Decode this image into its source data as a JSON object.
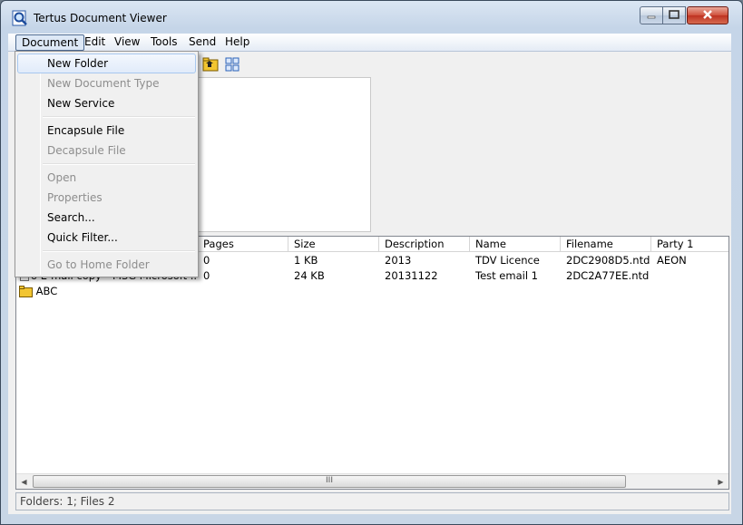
{
  "window": {
    "title": "Tertus Document Viewer"
  },
  "menubar": {
    "items": [
      "Document",
      "Edit",
      "View",
      "Tools",
      "Send",
      "Help"
    ]
  },
  "document_menu": {
    "items": [
      {
        "label": "New Folder",
        "enabled": true,
        "highlighted": true
      },
      {
        "label": "New Document Type",
        "enabled": false
      },
      {
        "label": "New Service",
        "enabled": true
      },
      {
        "label": "Encapsule File",
        "enabled": true
      },
      {
        "label": "Decapsule File",
        "enabled": false
      },
      {
        "label": "Open",
        "enabled": false
      },
      {
        "label": "Properties",
        "enabled": false
      },
      {
        "label": "Search...",
        "enabled": true
      },
      {
        "label": "Quick Filter...",
        "enabled": true
      },
      {
        "label": "Go to Home Folder",
        "enabled": false
      }
    ]
  },
  "toolbar": {
    "icons": [
      "folder-up-icon",
      "view-icon"
    ]
  },
  "list": {
    "columns": [
      "Pages",
      "Size",
      "Description",
      "Name",
      "Filename",
      "Party 1"
    ],
    "rows": [
      {
        "col1": "",
        "col2": "",
        "pages": "0",
        "size": "1 KB",
        "description": "2013",
        "name": "TDV Licence",
        "filename": "2DC2908D5.ntd",
        "party1": "AEON"
      },
      {
        "col1": "o E-mail copy",
        "col2": "MSG Microsoft ...",
        "pages": "0",
        "size": "24 KB",
        "description": "20131122",
        "name": "Test email 1",
        "filename": "2DC2A77EE.ntd",
        "party1": ""
      }
    ],
    "folder": {
      "label": "ABC"
    }
  },
  "scrollbar": {
    "grip": "III"
  },
  "status": {
    "text": "Folders: 1; Files 2"
  },
  "colors": {
    "accent": "#4d6b92",
    "folder_yellow": "#f2c531"
  }
}
